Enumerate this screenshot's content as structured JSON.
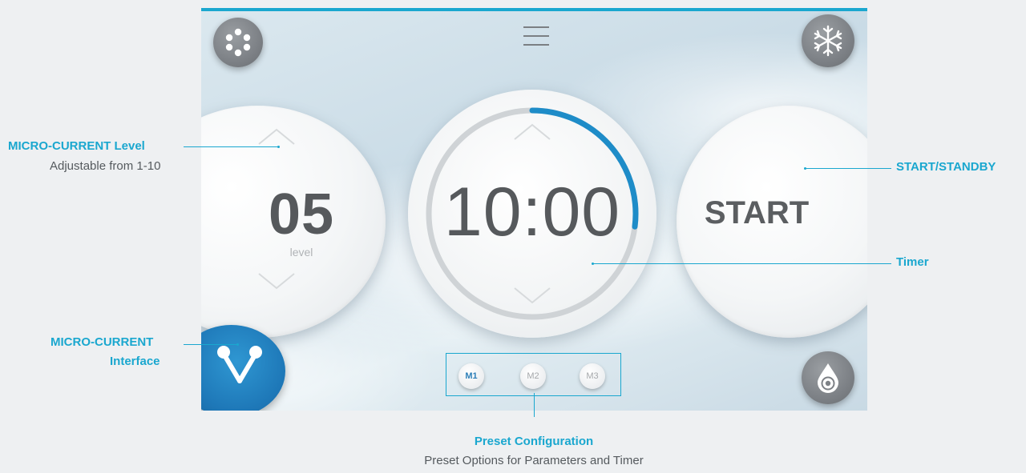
{
  "device": {
    "level": {
      "value": "05",
      "unit": "level"
    },
    "timer": {
      "value": "10:00",
      "progress": 0.27
    },
    "start_label": "START",
    "presets": [
      {
        "label": "M1",
        "active": true
      },
      {
        "label": "M2",
        "active": false
      },
      {
        "label": "M3",
        "active": false
      }
    ],
    "icons": {
      "top_left": "dots-circle-icon",
      "top_center": "menu-icon",
      "top_right": "snowflake-icon",
      "bottom_left": "micro-current-icon",
      "bottom_right": "water-drop-icon"
    },
    "colors": {
      "accent": "#1aa7cf",
      "ring": "#1e8cc8",
      "text": "#56595c"
    }
  },
  "annotations": {
    "level": {
      "title": "MICRO-CURRENT Level",
      "subtitle": "Adjustable from 1-10"
    },
    "interface": {
      "line1": "MICRO-CURRENT",
      "line2": "Interface"
    },
    "start": {
      "title": "START/STANDBY"
    },
    "timer": {
      "title": "Timer"
    },
    "preset": {
      "title": "Preset Configuration",
      "subtitle": "Preset Options for Parameters and Timer"
    }
  }
}
